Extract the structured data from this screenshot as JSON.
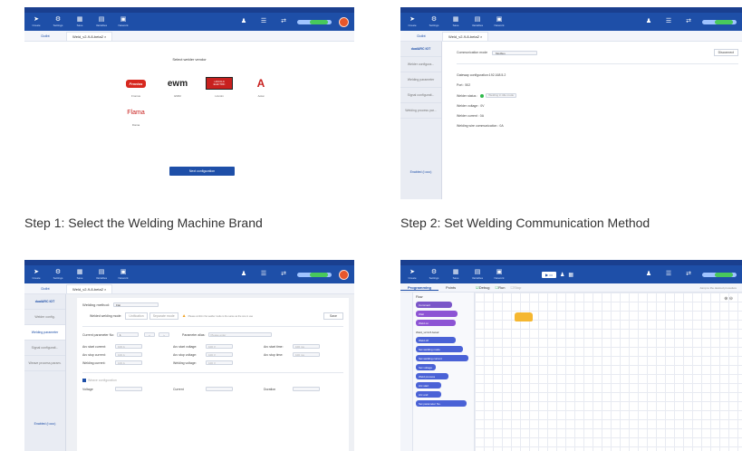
{
  "toolbar": {
    "items": [
      "Create",
      "Settings",
      "Save",
      "Variables",
      "Network",
      "Web Document"
    ],
    "right_items": [
      "Stack",
      "Log",
      "Monitor",
      "Speed 20%"
    ]
  },
  "panels": {
    "step1": {
      "home_tab": "Dolbt",
      "doc_tab": "Weld_v2-9-8-beta2 ×",
      "heading": "Select welder vendor",
      "vendors": [
        {
          "logo": "Fronius",
          "name": "Fronius"
        },
        {
          "logo": "ewm",
          "name": "EWM"
        },
        {
          "logo": "LINCOLN ELECTRIC",
          "name": "Lincoln"
        },
        {
          "logo": "A",
          "name": "Aotai"
        },
        {
          "logo": "Flama",
          "name": "Flama"
        }
      ],
      "next_button": "Next configuration",
      "caption": "Step 1: Select the Welding Machine Brand"
    },
    "step2": {
      "home_tab": "Dolbt",
      "doc_tab": "Weld_v2-9-8-beta2 ×",
      "sidebar_head": "dualARC IOT",
      "sidebar_items": [
        "Welder configura...",
        "Welding parameter",
        "Signal configurati...",
        "Welding process par..."
      ],
      "sidebar_bottom": "Enabled (i ooo)",
      "comm_mode_label": "Communication mode",
      "comm_mode_value": "Modbus",
      "disconnect": "Disconnect",
      "gateway": "Gateway configuration:192.168.5.2",
      "port": "Port : 502",
      "welder_status_label": "Welder status :",
      "welder_status_value": "Welding in idle mode",
      "welder_voltage": "Welder voltage : 0V",
      "welder_current": "Welder current : 0A",
      "welding_wire": "Welding wire communication : 0A",
      "caption": "Step 2: Set Welding Communication Method"
    },
    "step3": {
      "home_tab": "Dolbt",
      "doc_tab": "Weld_v2-9-8-beta2 ×",
      "sidebar_head": "dualARC IOT",
      "sidebar_items": [
        "Welder config.",
        "Welding parameter",
        "Signal configurati...",
        "Weave process param."
      ],
      "sidebar_bottom": "Enabled (i ooo)",
      "welding_method_label": "Welding method:",
      "welding_method_value": "Flat",
      "mode_label": "Welded welding mode:",
      "mode_options": [
        "Unification",
        "Separate mode"
      ],
      "mode_warning": "Please confirm the welder mode is the same as the one in use",
      "save": "Save",
      "current_param_label": "Current parameter No:",
      "current_param_value": "1",
      "param_alias_label": "Parameter alias:",
      "param_alias_placeholder": "Please enter",
      "col1": [
        "Arc start current:",
        "Arc stop current:",
        "Welding current:"
      ],
      "col2": [
        "Arc start voltage:",
        "Arc stop voltage:",
        "Welding voltage:"
      ],
      "col3": [
        "Arc start time:",
        "Arc stop time:"
      ],
      "unit_a": "A",
      "unit_v": "V",
      "unit_ms": "ms",
      "field_val": "100",
      "wave_label": "Weave configuration",
      "wave_fields": [
        "Voltage",
        "Current",
        "Duration"
      ],
      "caption": "Step 3: Configure Welding Parameters"
    },
    "step4": {
      "tabs": [
        "Programming",
        "Points"
      ],
      "toolbar_actions": [
        "Debug",
        "Run",
        "Stop"
      ],
      "right_link": "Jump to the desired procedure",
      "palette": [
        "Flow",
        "Motion",
        "Logic",
        "Vars",
        "IO",
        "Weld",
        "Math",
        "Text",
        "Lists",
        "Func",
        "Event",
        "Custom"
      ],
      "blocks": [
        "Comment",
        "Weld_v2-9-8-beta2",
        "Wait",
        "Weld on",
        "Weld off",
        "Set welding mode",
        "Set welding current",
        "Set voltage",
        "Weld process",
        "Arc start",
        "Arc end",
        "Set parameter No."
      ],
      "caption": "Step 4: Write the Welding Program"
    }
  }
}
